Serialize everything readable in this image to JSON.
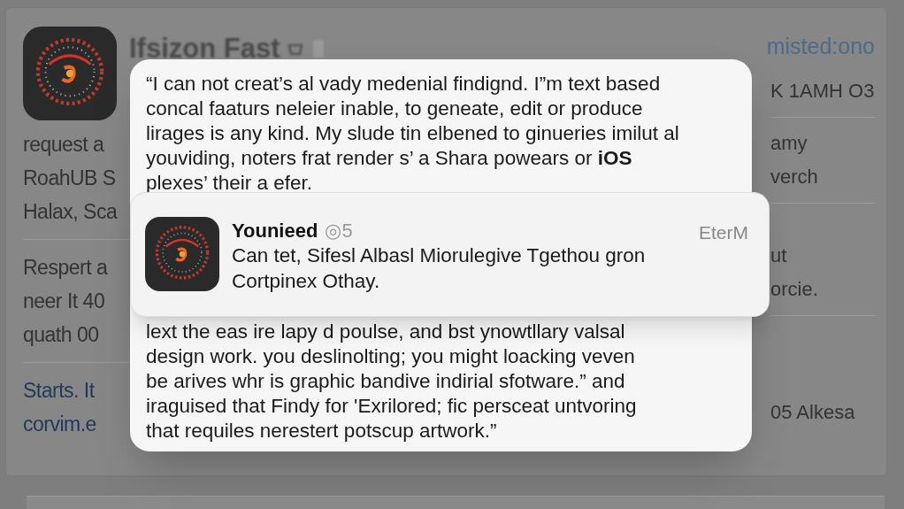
{
  "background": {
    "app_title": "Ifsizon Fast",
    "account": "misted:ono",
    "left_groups": [
      [
        "request a",
        "RoahUB S",
        "Halax, Sca"
      ],
      [
        "Respert a",
        "neer It 40",
        "quath 00"
      ],
      [
        "Starts. It",
        "corvim.e"
      ]
    ],
    "right_groups": [
      [
        "K 1AMH O3"
      ],
      [
        "amy",
        "verch"
      ],
      [
        "ut",
        "orcie."
      ],
      [
        "05 Alkesa"
      ]
    ]
  },
  "message": {
    "paragraph_1": [
      "“I can not creat’s al vady medenial findignd. I”m text based",
      "concal faaturs neleier inable, to geneate, edit or produce",
      "lirages is any kind. My slude tin elbened to ginueries imilut al",
      "youviding, noters frat render s’ a Shara powears or **iOS**",
      "plexes’ their a efer."
    ],
    "paragraph_2": [
      "lext the eas ire lapy d poulse, and bst ynowtllary valsal",
      "design work. you deslinolting; you might loacking veven",
      "be arives whr is graphic bandive indirial sfotware.” and",
      "iraguised that Findy for 'Exrilored; fic persceat untvoring",
      "that requiles nerestert potscup artwork.”"
    ]
  },
  "notification": {
    "sender": "Younieed",
    "badge": "◎5",
    "time": "EterM",
    "body": [
      "Can tet, Sifesl Albasl Miorulegive Tgethou gron",
      "Cortpinex Othay."
    ]
  }
}
